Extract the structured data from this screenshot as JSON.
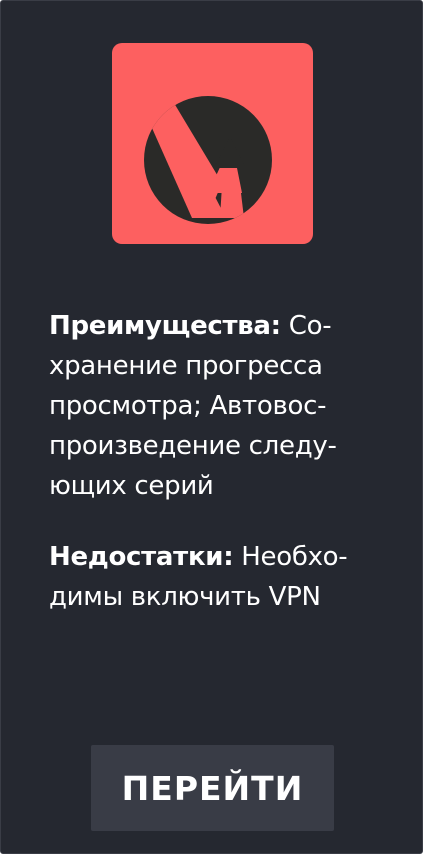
{
  "app": {
    "logo_icon": "anixart-a-logo-icon",
    "logo_color": "#fd6060",
    "card_color": "#252830",
    "button_color": "#393c46"
  },
  "pros": {
    "label": "Преимущества:",
    "lines": [
      "Со-",
      "хранение прогресса",
      "просмотра; Автовос-",
      "произведение следу-",
      "ющих серий"
    ]
  },
  "cons": {
    "label": "Недостатки:",
    "lines": [
      "Необхо-",
      "димы включить VPN"
    ]
  },
  "button": {
    "label": "ПЕРЕЙТИ"
  }
}
